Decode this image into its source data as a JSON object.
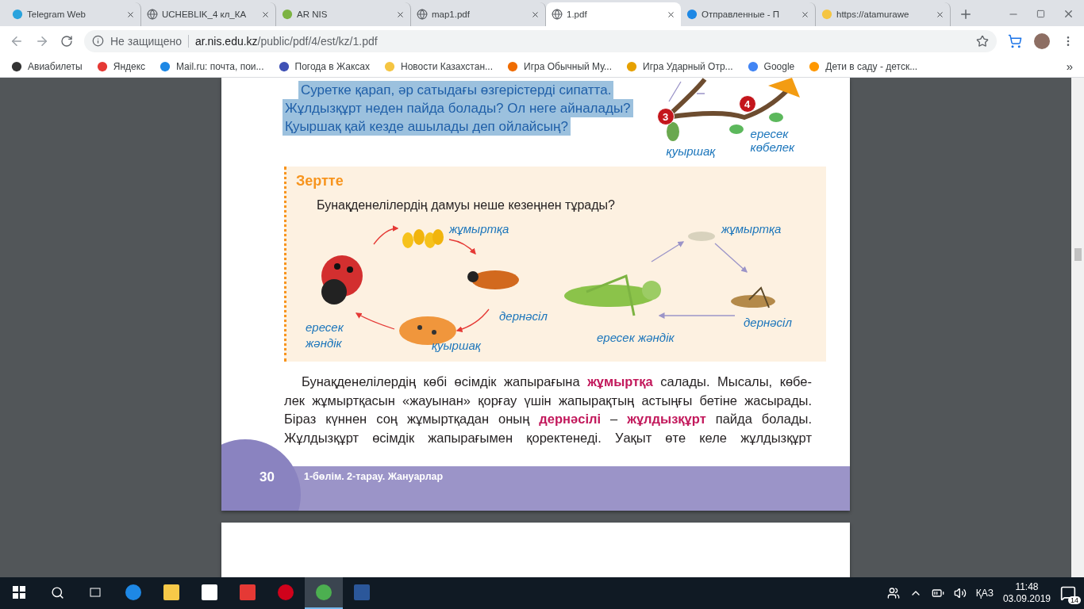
{
  "browser": {
    "tabs": [
      {
        "title": "Telegram Web",
        "kind": "telegram",
        "selected": false
      },
      {
        "title": "UCHEBLIK_4 кл_КА",
        "kind": "globe",
        "selected": false
      },
      {
        "title": "AR NIS",
        "kind": "leaf",
        "selected": false
      },
      {
        "title": "map1.pdf",
        "kind": "globe",
        "selected": false
      },
      {
        "title": "1.pdf",
        "kind": "globe",
        "selected": true
      },
      {
        "title": "Отправленные - П",
        "kind": "mail",
        "selected": false
      },
      {
        "title": "https://atamurawe",
        "kind": "sun",
        "selected": false
      }
    ],
    "address": {
      "security": "Не защищено",
      "host": "ar.nis.edu.kz",
      "path": "/public/pdf/4/est/kz/1.pdf"
    },
    "bookmarks": [
      {
        "title": "Авиабилеты",
        "kind": "plane"
      },
      {
        "title": "Яндекс",
        "kind": "yandex"
      },
      {
        "title": "Mail.ru: почта, пои...",
        "kind": "mail"
      },
      {
        "title": "Погода в Жаксах",
        "kind": "cloud"
      },
      {
        "title": "Новости Казахстан...",
        "kind": "sun"
      },
      {
        "title": "Игра Обычный Му...",
        "kind": "ball"
      },
      {
        "title": "Игра Ударный Отр...",
        "kind": "face"
      },
      {
        "title": "Google",
        "kind": "google"
      },
      {
        "title": "Дети в саду - детск...",
        "kind": "puzzle"
      }
    ],
    "more": "»"
  },
  "page": {
    "question": {
      "highlighted": true,
      "lines": [
        "Суретке қарап, әр сатыдағы өзгерістерді сипатта.",
        "Жұлдызқұрт неден пайда болады? Ол неге айналады?",
        "Қуыршақ қай кезде ашылады деп ойлайсың?"
      ]
    },
    "butterfly_figure": {
      "stage_a": "3",
      "stage_b": "4",
      "pupa": "қуыршақ",
      "adult": "ересек көбелек"
    },
    "research": {
      "title": "Зертте",
      "question": "Бунақденелілердің дамуы неше кезеңнен тұрады?",
      "ladybug_cycle": {
        "egg": "жұмыртқа",
        "larva": "дернәсіл",
        "pupa": "қуыршақ",
        "adult": "ересек жәндік"
      },
      "grasshopper_cycle": {
        "egg": "жұмыртқа",
        "larva": "дернәсіл",
        "adult": "ересек жәндік"
      }
    },
    "paragraph": [
      "Бунақденелілердің көбі өсімдік жапырағына **жұмыртқа** салады. Мысалы, көбе-",
      "лек жұмыртқасын «жауынан» қорғау үшін жапырақтың астыңғы бетіне жасырады.",
      "Біраз күннен соң жұмыртқадан оның **дернәсілі** – **жұлдызқұрт** пайда болады.",
      "Жұлдызқұрт өсімдік жапырағымен қоректенеді. Уақыт өте келе жұлдызқұрт"
    ],
    "footer": {
      "page_number": "30",
      "chapter": "1-бөлім. 2-тарау. Жануарлар"
    }
  },
  "taskbar": {
    "apps": [
      {
        "kind": "edge",
        "active": false
      },
      {
        "kind": "folder",
        "active": false
      },
      {
        "kind": "store",
        "active": false
      },
      {
        "kind": "yandex",
        "active": false
      },
      {
        "kind": "opera",
        "active": false
      },
      {
        "kind": "chrome",
        "active": true
      },
      {
        "kind": "word",
        "active": false
      }
    ],
    "language": "ҚАЗ",
    "time": "11:48",
    "date": "03.09.2019",
    "notifications": "14"
  }
}
